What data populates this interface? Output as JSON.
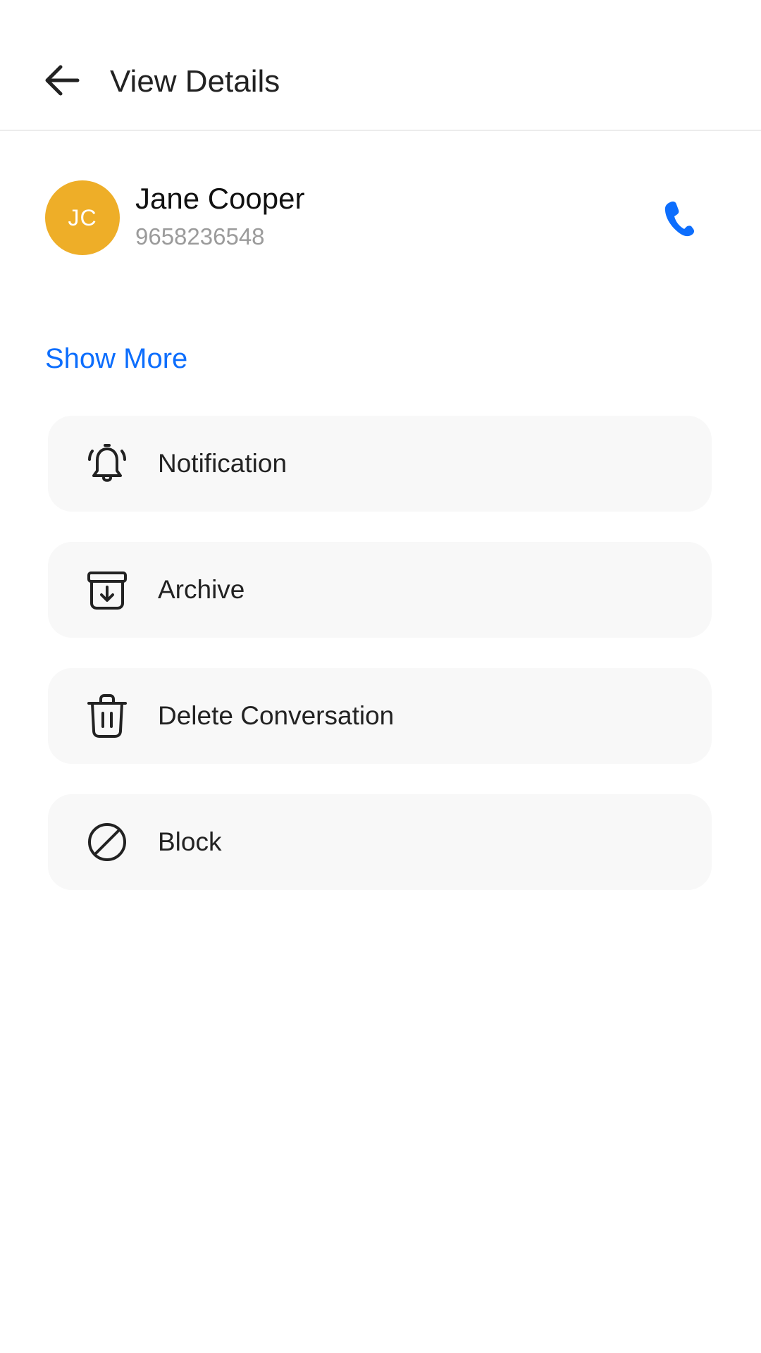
{
  "header": {
    "title": "View Details",
    "back_icon": "arrow-left-icon"
  },
  "contact": {
    "initials": "JC",
    "name": "Jane Cooper",
    "phone": "9658236548",
    "avatar_color": "#eeae28",
    "call_icon": "phone-icon",
    "call_color": "#0d6efd"
  },
  "show_more": {
    "label": "Show More",
    "color": "#0d6efd"
  },
  "actions": [
    {
      "label": "Notification",
      "icon": "bell-icon"
    },
    {
      "label": "Archive",
      "icon": "archive-icon"
    },
    {
      "label": "Delete Conversation",
      "icon": "trash-icon"
    },
    {
      "label": "Block",
      "icon": "block-icon"
    }
  ]
}
